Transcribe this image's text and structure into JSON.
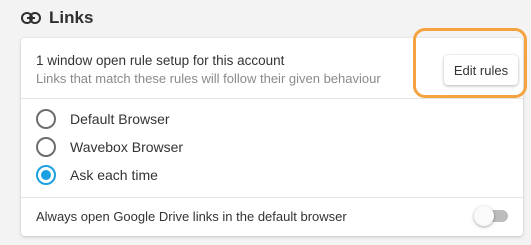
{
  "section": {
    "title": "Links",
    "icon": "link-icon"
  },
  "rules": {
    "title": "1 window open rule setup for this account",
    "subtitle": "Links that match these rules will follow their given behaviour",
    "edit_label": "Edit rules"
  },
  "open_options": {
    "selected": "Ask each time",
    "items": [
      {
        "label": "Default Browser",
        "checked": false
      },
      {
        "label": "Wavebox Browser",
        "checked": false
      },
      {
        "label": "Ask each time",
        "checked": true
      }
    ]
  },
  "drive_setting": {
    "label": "Always open Google Drive links in the default browser",
    "enabled": false
  },
  "colors": {
    "accent": "#1ba1e2",
    "highlight": "#f4a340",
    "background": "#f3f3f3"
  }
}
